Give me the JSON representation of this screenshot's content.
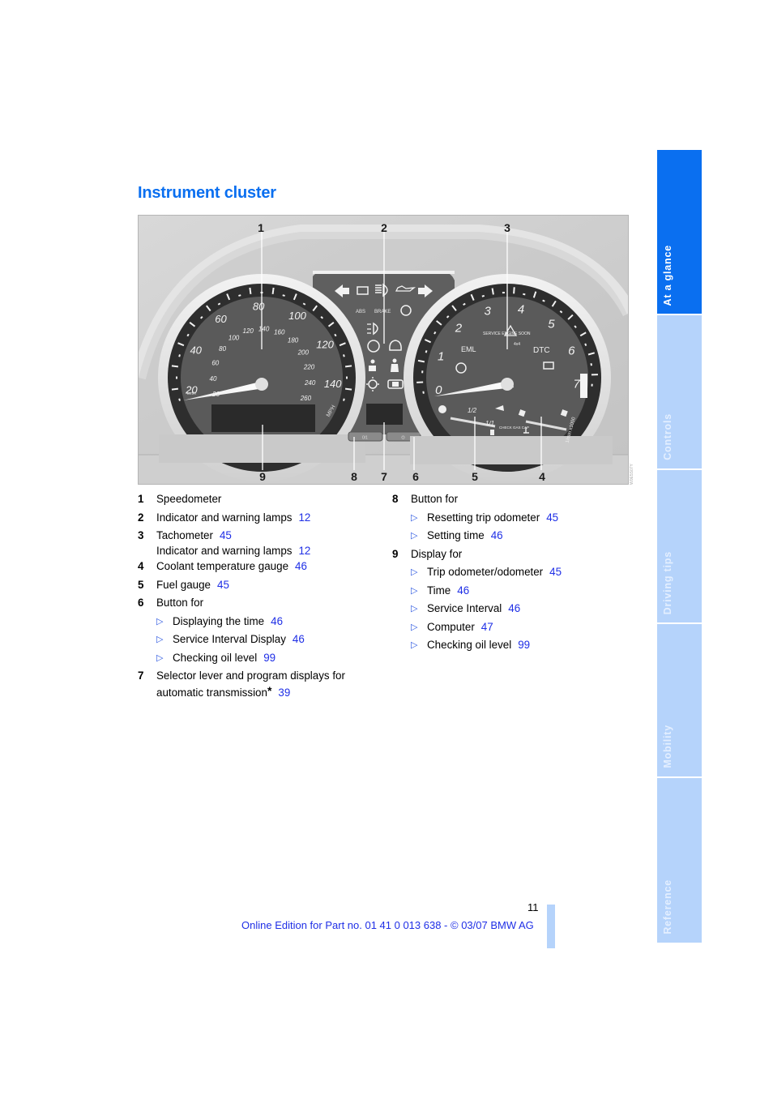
{
  "page": {
    "title": "Instrument cluster",
    "page_number": "11",
    "footer": "Online Edition for Part no. 01 41 0 013 638 - © 03/07 BMW AG"
  },
  "colors": {
    "accent": "#0a6ff0",
    "tab_inactive": "#b5d3fb",
    "link": "#1f2fe6"
  },
  "side_tabs": [
    {
      "label": "At a glance",
      "active": true
    },
    {
      "label": "Controls",
      "active": false
    },
    {
      "label": "Driving tips",
      "active": false
    },
    {
      "label": "Mobility",
      "active": false
    },
    {
      "label": "Reference",
      "active": false
    }
  ],
  "figure": {
    "image_id": "W0E5S07Y",
    "callouts_top": [
      "1",
      "2",
      "3"
    ],
    "callouts_bottom": [
      "9",
      "8",
      "7",
      "6",
      "5",
      "4"
    ],
    "speedometer": {
      "mph_labels": [
        "20",
        "40",
        "60",
        "80",
        "100",
        "120",
        "140"
      ],
      "kmh_labels": [
        "20",
        "40",
        "60",
        "80",
        "100",
        "120",
        "140",
        "160",
        "180",
        "200",
        "220",
        "240",
        "260"
      ],
      "unit_inner": "km/h",
      "unit_outer": "MPH"
    },
    "tachometer": {
      "labels": [
        "0",
        "1",
        "2",
        "3",
        "4",
        "5",
        "6",
        "7"
      ],
      "unit": "1/min x1000",
      "text_eml": "EML",
      "text_dtc": "DTC",
      "text_service": "SERVICE ENGINE SOON",
      "text_4x4": "4x4"
    },
    "fuel_gauge": {
      "label_half": "1/2",
      "label_full": "1/1",
      "check_cap": "CHECK GAS CAP"
    },
    "warning_panel": {
      "abs": "ABS",
      "brake": "BRAKE"
    },
    "buttons": {
      "left": "0/1",
      "right": "⊙"
    }
  },
  "legend": {
    "col1": [
      {
        "num": "1",
        "text": "Speedometer",
        "ref": ""
      },
      {
        "num": "2",
        "text": "Indicator and warning lamps",
        "ref": "12"
      },
      {
        "num": "3",
        "text": "Tachometer",
        "ref": "45",
        "line2": "Indicator and warning lamps",
        "line2_ref": "12"
      },
      {
        "num": "4",
        "text": "Coolant temperature gauge",
        "ref": "46"
      },
      {
        "num": "5",
        "text": "Fuel gauge",
        "ref": "45"
      },
      {
        "num": "6",
        "text": "Button for",
        "ref": "",
        "subs": [
          {
            "text": "Displaying the time",
            "ref": "46"
          },
          {
            "text": "Service Interval Display",
            "ref": "46"
          },
          {
            "text": "Checking oil level",
            "ref": "99"
          }
        ]
      },
      {
        "num": "7",
        "text": "Selector lever and program displays for",
        "cont": "automatic transmission",
        "star": "*",
        "ref": "39"
      }
    ],
    "col2": [
      {
        "num": "8",
        "text": "Button for",
        "subs": [
          {
            "text": "Resetting trip odometer",
            "ref": "45"
          },
          {
            "text": "Setting time",
            "ref": "46"
          }
        ]
      },
      {
        "num": "9",
        "text": "Display for",
        "subs": [
          {
            "text": "Trip odometer/odometer",
            "ref": "45"
          },
          {
            "text": "Time",
            "ref": "46"
          },
          {
            "text": "Service Interval",
            "ref": "46"
          },
          {
            "text": "Computer",
            "ref": "47"
          },
          {
            "text": "Checking oil level",
            "ref": "99"
          }
        ]
      }
    ]
  },
  "bullet_icon": "triangle-right-outline"
}
